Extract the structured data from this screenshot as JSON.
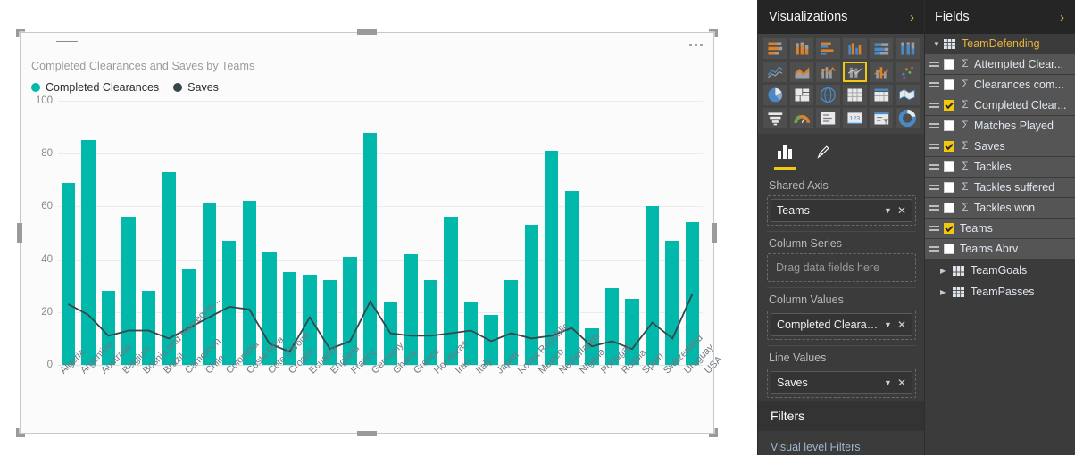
{
  "visual": {
    "title": "Completed Clearances and Saves by Teams",
    "more_label": "More options",
    "legend": [
      {
        "label": "Completed Clearances",
        "color": "#01b8aa"
      },
      {
        "label": "Saves",
        "color": "#374649"
      }
    ]
  },
  "chart_data": {
    "type": "bar",
    "title": "Completed Clearances and Saves by Teams",
    "xlabel": "Teams",
    "ylabel": "",
    "ylim": [
      0,
      100
    ],
    "yticks": [
      0,
      20,
      40,
      60,
      80,
      100
    ],
    "grid": true,
    "legend_position": "top-left",
    "categories": [
      "Algeria",
      "Argentina",
      "Australia",
      "Belgium",
      "Bosnia and Herzegovi...",
      "Brazil",
      "Cameroon",
      "Chile",
      "Colombia",
      "Costa Rica",
      "Côte d'Ivoire",
      "Croatia",
      "Ecuador",
      "England",
      "France",
      "Germany",
      "Ghana",
      "Greece",
      "Honduras",
      "Iran",
      "Italy",
      "Japan",
      "Korea Republic",
      "Mexico",
      "Netherlands",
      "Nigeria",
      "Portugal",
      "Russia",
      "Spain",
      "Switzerland",
      "Uruguay",
      "USA"
    ],
    "series": [
      {
        "name": "Completed Clearances",
        "type": "column",
        "color": "#01b8aa",
        "values": [
          69,
          85,
          28,
          56,
          28,
          73,
          36,
          61,
          47,
          62,
          43,
          35,
          34,
          32,
          41,
          88,
          24,
          42,
          32,
          56,
          24,
          19,
          32,
          53,
          81,
          66,
          14,
          29,
          25,
          60,
          47,
          54
        ]
      },
      {
        "name": "Saves",
        "type": "line",
        "color": "#374649",
        "values": [
          23,
          19,
          11,
          13,
          13,
          10,
          14,
          18,
          22,
          21,
          8,
          5,
          18,
          6,
          9,
          24,
          12,
          11,
          11,
          12,
          13,
          9,
          12,
          10,
          11,
          14,
          7,
          9,
          6,
          16,
          10,
          27
        ]
      }
    ]
  },
  "visualizations": {
    "title": "Visualizations",
    "expand_icon": "chevron-right-icon",
    "selected_index": 9,
    "icons": [
      "stacked-bar-chart-icon",
      "stacked-column-chart-icon",
      "clustered-bar-chart-icon",
      "clustered-column-chart-icon",
      "100-stacked-bar-chart-icon",
      "100-stacked-column-chart-icon",
      "line-chart-icon",
      "area-chart-icon",
      "stacked-area-chart-icon",
      "line-and-stacked-column-chart-icon",
      "line-and-clustered-column-chart-icon",
      "scatter-chart-icon",
      "pie-chart-icon",
      "treemap-icon",
      "map-icon",
      "table-icon",
      "matrix-icon",
      "filled-map-icon",
      "funnel-icon",
      "gauge-icon",
      "card-icon",
      "multi-row-card-icon",
      "slicer-icon",
      "donut-chart-icon"
    ],
    "tabs": [
      {
        "name": "fields-tab",
        "icon": "bar-chart-icon",
        "active": true
      },
      {
        "name": "format-tab",
        "icon": "paintbrush-icon",
        "active": false
      }
    ],
    "wells": [
      {
        "label": "Shared Axis",
        "chips": [
          {
            "name": "Teams"
          }
        ],
        "placeholder": null
      },
      {
        "label": "Column Series",
        "chips": [],
        "placeholder": "Drag data fields here"
      },
      {
        "label": "Column Values",
        "chips": [
          {
            "name": "Completed Clearances"
          }
        ],
        "placeholder": null
      },
      {
        "label": "Line Values",
        "chips": [
          {
            "name": "Saves"
          }
        ],
        "placeholder": null
      }
    ],
    "filters": {
      "title": "Filters",
      "subtitle": "Visual level Filters"
    }
  },
  "fields": {
    "title": "Fields",
    "expand_icon": "chevron-right-icon",
    "tables": [
      {
        "name": "TeamDefending",
        "expanded": true,
        "items": [
          {
            "label": "Attempted Clear...",
            "checked": false,
            "measure": true
          },
          {
            "label": "Clearances com...",
            "checked": false,
            "measure": true
          },
          {
            "label": "Completed Clear...",
            "checked": true,
            "measure": true
          },
          {
            "label": "Matches Played",
            "checked": false,
            "measure": true
          },
          {
            "label": "Saves",
            "checked": true,
            "measure": true
          },
          {
            "label": "Tackles",
            "checked": false,
            "measure": true
          },
          {
            "label": "Tackles suffered",
            "checked": false,
            "measure": true
          },
          {
            "label": "Tackles won",
            "checked": false,
            "measure": true
          },
          {
            "label": "Teams",
            "checked": true,
            "measure": false
          },
          {
            "label": "Teams Abrv",
            "checked": false,
            "measure": false
          }
        ]
      },
      {
        "name": "TeamGoals",
        "expanded": false,
        "items": []
      },
      {
        "name": "TeamPasses",
        "expanded": false,
        "items": []
      }
    ]
  }
}
